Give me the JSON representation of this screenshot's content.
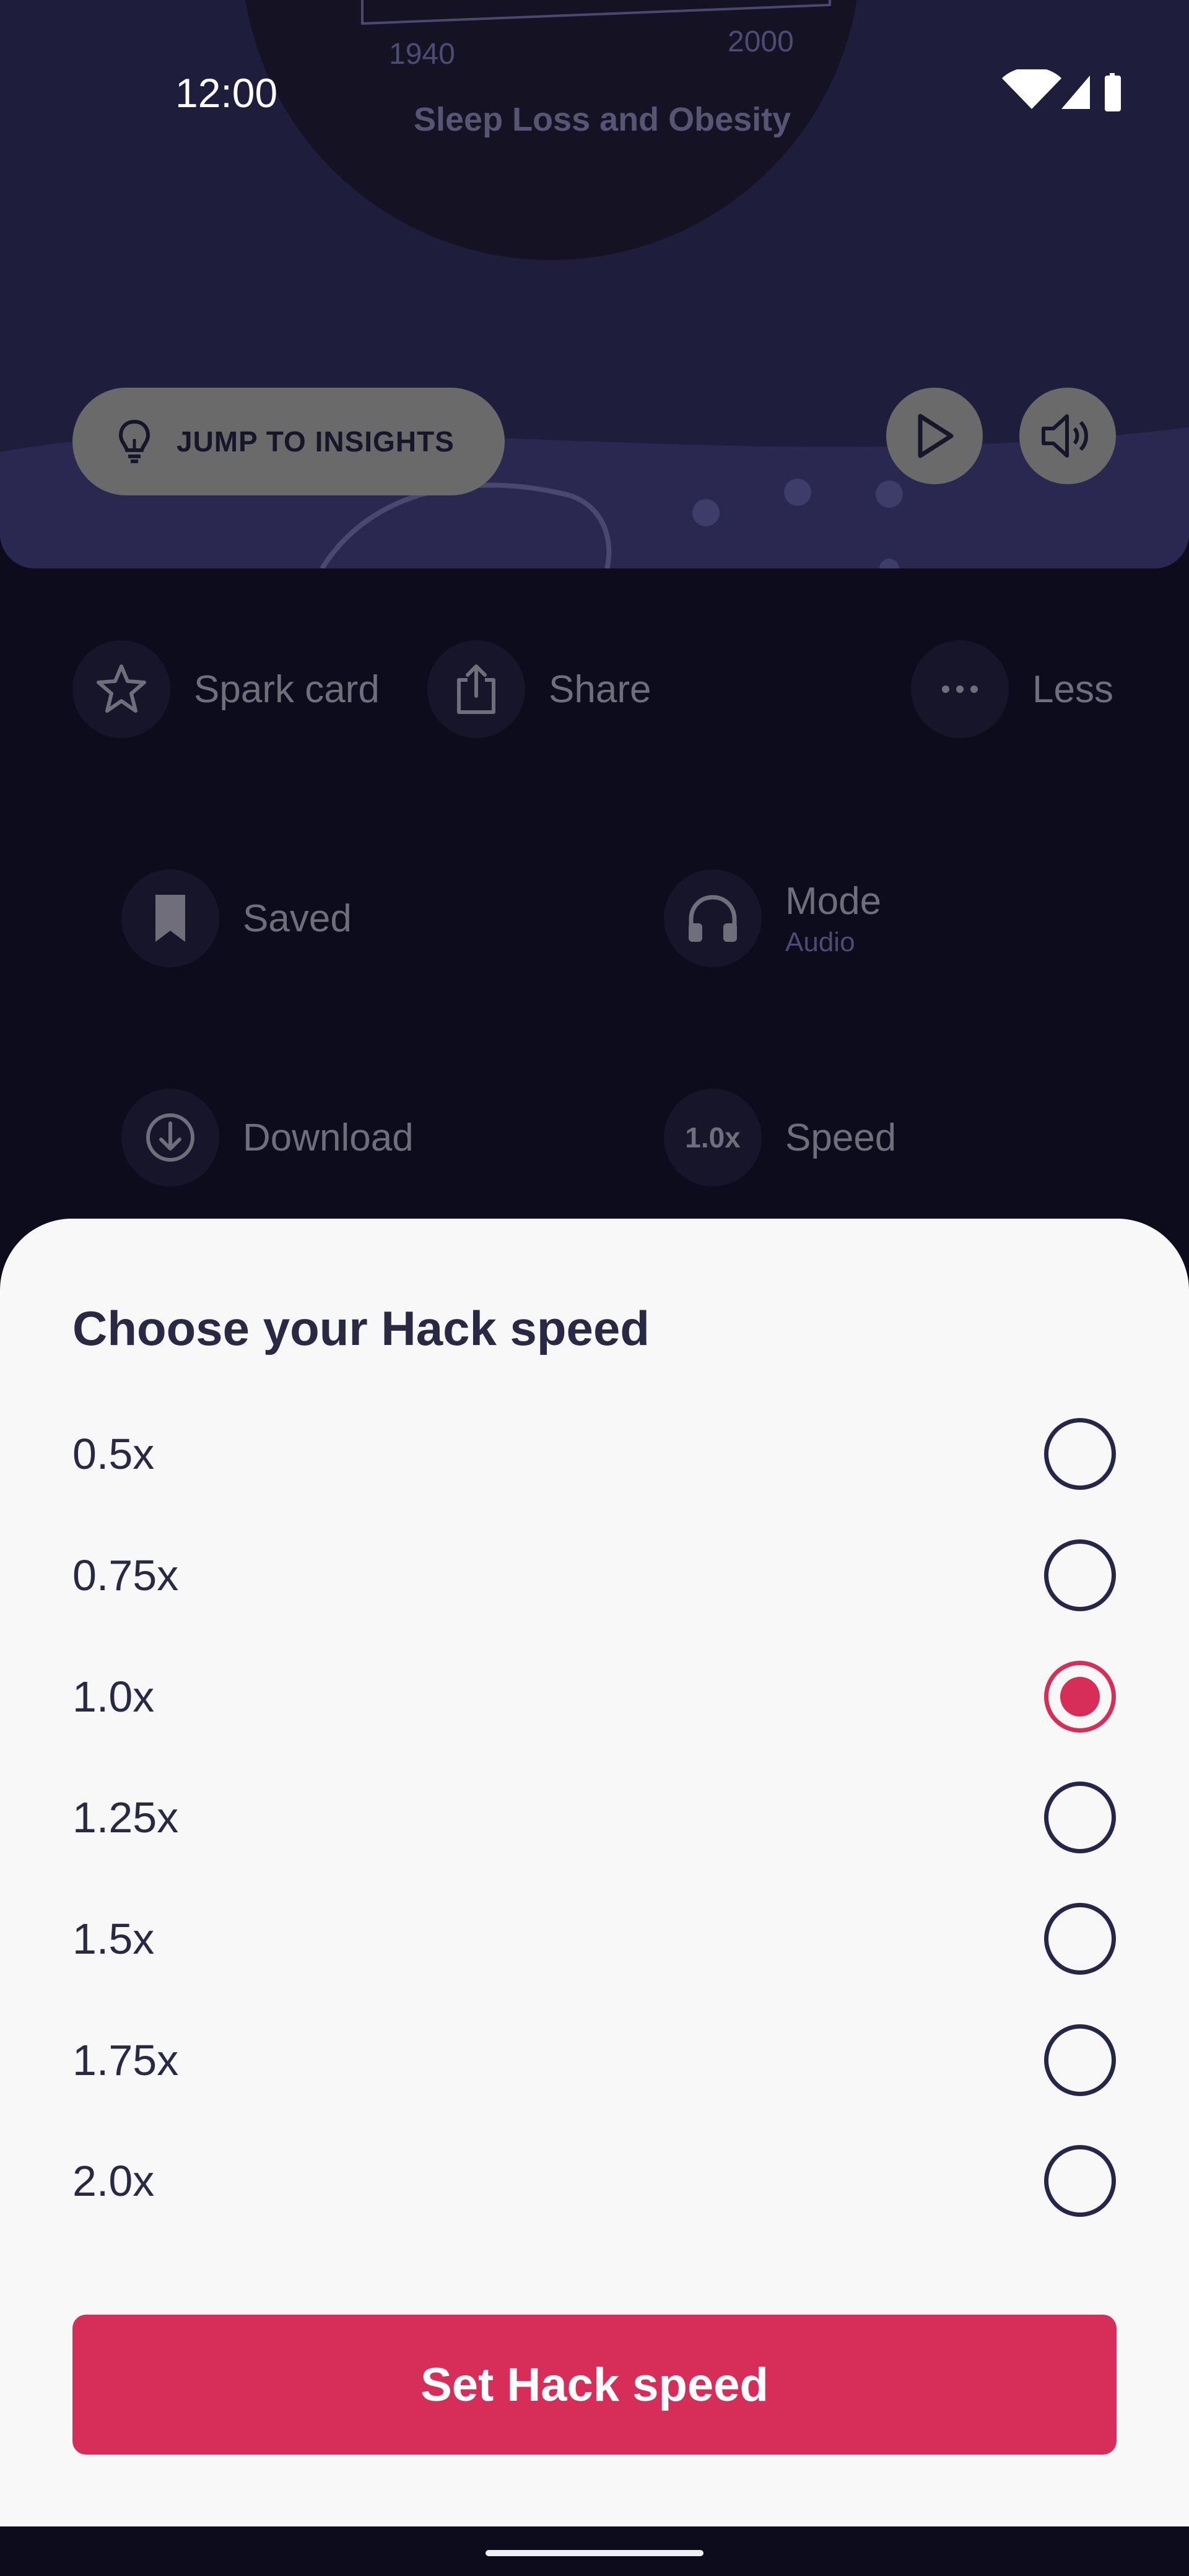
{
  "status_bar": {
    "time": "12:00"
  },
  "hero": {
    "chart_caption": "Sleep Loss and Obesity",
    "axis_labels": [
      "1940",
      "2000"
    ],
    "jump_button_label": "JUMP TO INSIGHTS"
  },
  "actions": {
    "spark_card": "Spark card",
    "share": "Share",
    "less": "Less",
    "saved": "Saved",
    "mode": "Mode",
    "mode_value": "Audio",
    "download": "Download",
    "speed_badge": "1.0x",
    "speed": "Speed"
  },
  "sheet": {
    "title": "Choose your Hack speed",
    "options": [
      {
        "label": "0.5x"
      },
      {
        "label": "0.75x"
      },
      {
        "label": "1.0x",
        "selected": true
      },
      {
        "label": "1.25x"
      },
      {
        "label": "1.5x"
      },
      {
        "label": "1.75x"
      },
      {
        "label": "2.0x"
      }
    ],
    "submit_label": "Set Hack speed"
  },
  "colors": {
    "accent": "#d62e58",
    "hero_bg": "#1f1d3c",
    "page_bg": "#0d0c1c",
    "sheet_bg": "#f8f8f8"
  },
  "icons": [
    "wifi-icon",
    "signal-icon",
    "battery-icon",
    "lightbulb-icon",
    "play-icon",
    "volume-icon",
    "star-icon",
    "share-icon",
    "more-icon",
    "bookmark-icon",
    "headphones-icon",
    "download-icon"
  ]
}
